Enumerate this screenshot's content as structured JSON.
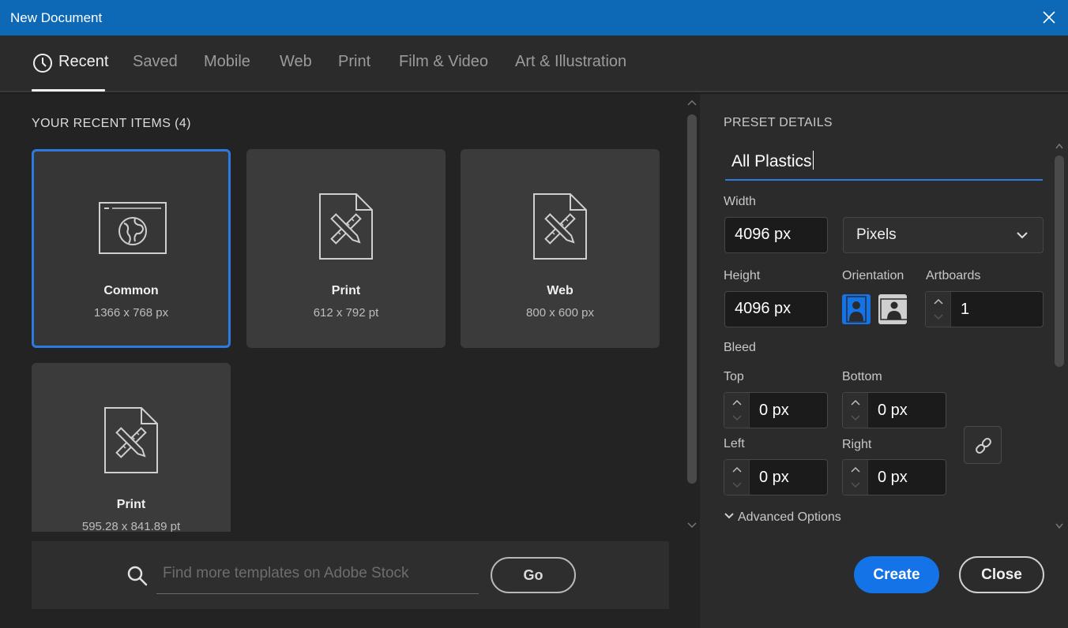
{
  "window": {
    "title": "New Document"
  },
  "tabs": [
    {
      "label": "Recent",
      "active": true
    },
    {
      "label": "Saved"
    },
    {
      "label": "Mobile"
    },
    {
      "label": "Web"
    },
    {
      "label": "Print"
    },
    {
      "label": "Film & Video"
    },
    {
      "label": "Art & Illustration"
    }
  ],
  "recent": {
    "section_title": "YOUR RECENT ITEMS  (4)",
    "items": [
      {
        "name": "Common",
        "size": "1366 x 768 px",
        "icon": "web-globe-icon"
      },
      {
        "name": "Print",
        "size": "612 x 792 pt",
        "icon": "document-ruler-pencil-icon"
      },
      {
        "name": "Web",
        "size": "800 x 600 px",
        "icon": "document-ruler-pencil-icon"
      },
      {
        "name": "Print",
        "size": "595.28 x 841.89 pt",
        "icon": "document-ruler-pencil-icon"
      }
    ]
  },
  "stock": {
    "placeholder": "Find more templates on Adobe Stock",
    "go_label": "Go"
  },
  "preset": {
    "heading": "PRESET DETAILS",
    "name": "All Plastics",
    "width_label": "Width",
    "width_value": "4096 px",
    "units": "Pixels",
    "height_label": "Height",
    "height_value": "4096 px",
    "orientation_label": "Orientation",
    "artboards_label": "Artboards",
    "artboards_value": "1",
    "bleed_label": "Bleed",
    "top_label": "Top",
    "top_value": "0 px",
    "bottom_label": "Bottom",
    "bottom_value": "0 px",
    "left_label": "Left",
    "left_value": "0 px",
    "right_label": "Right",
    "right_value": "0 px",
    "advanced_label": "Advanced Options"
  },
  "buttons": {
    "create": "Create",
    "close": "Close"
  },
  "colors": {
    "accent": "#1473e6",
    "titlebar": "#0d69b5",
    "selected_border": "#2d7be0"
  }
}
